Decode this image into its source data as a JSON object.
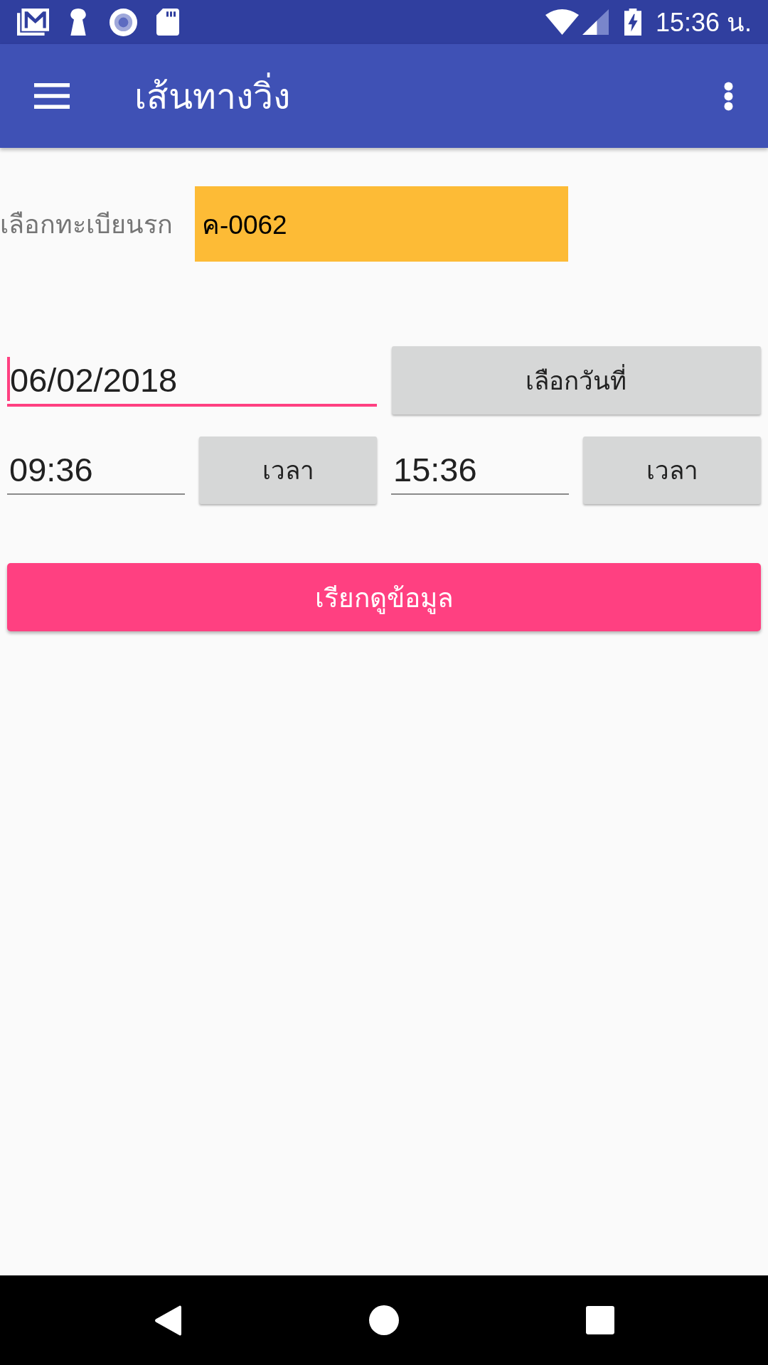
{
  "status_bar": {
    "time": "15:36 น."
  },
  "app_bar": {
    "title": "เส้นทางวิ่ง"
  },
  "vehicle_picker": {
    "label": "เลือกทะเบียนรก",
    "value": "ค-0062"
  },
  "date_row": {
    "field": {
      "value": "06/02/2018",
      "focused": true
    },
    "button": "เลือกวันที่"
  },
  "time_rows": [
    {
      "field": {
        "value": "09:36",
        "focused": false
      },
      "button": "เวลา"
    },
    {
      "field": {
        "value": "15:36",
        "focused": false
      },
      "button": "เวลา"
    }
  ],
  "submit_button": "เรียกดูข้อมูล"
}
